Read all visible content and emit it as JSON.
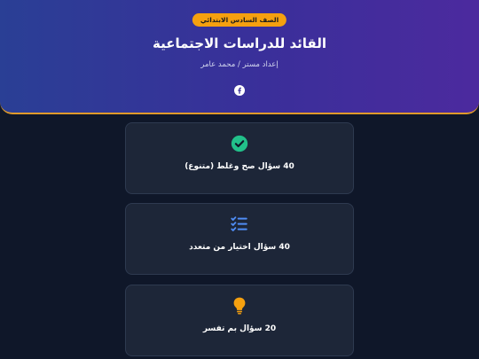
{
  "header": {
    "badge": "الصف السادس الابتدائي",
    "title": "القائد للدراسات الاجتماعية",
    "author": "إعداد مستر / محمد عامر",
    "social_icon": "facebook-icon"
  },
  "cards": [
    {
      "icon": "check-circle-icon",
      "label": "40 سؤال صح وغلط (متنوع)",
      "color": "#22c08a"
    },
    {
      "icon": "checklist-icon",
      "label": "40 سؤال اختيار من متعدد",
      "color": "#4f8df5"
    },
    {
      "icon": "lightbulb-icon",
      "label": "20 سؤال بم تفسر",
      "color": "#f5a00f"
    }
  ],
  "colors": {
    "background": "#0f1729",
    "card": "#1d2638",
    "header_border": "#e09a2a",
    "badge": "#f5a00f"
  }
}
